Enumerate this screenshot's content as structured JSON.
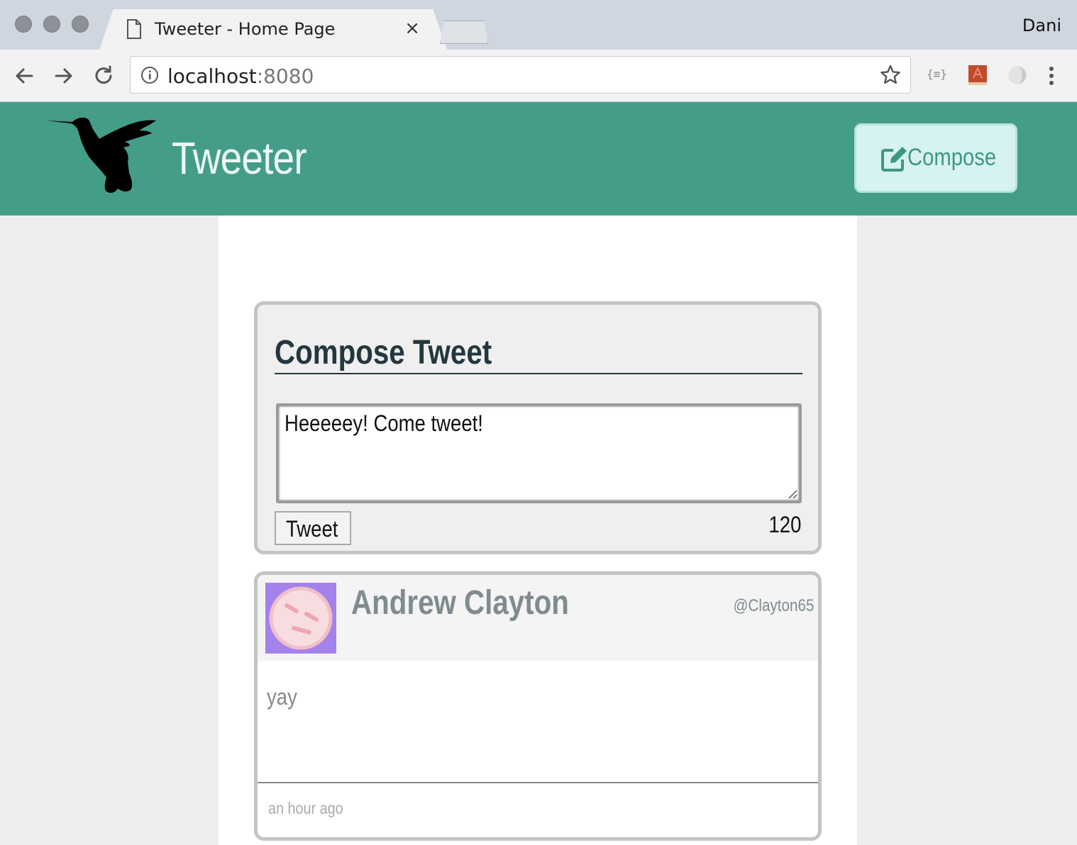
{
  "browser": {
    "tab_title": "Tweeter - Home Page",
    "profile_name": "Dani",
    "url_host": "localhost",
    "url_port": ":8080",
    "icons": [
      "back-icon",
      "forward-icon",
      "reload-icon",
      "info-icon",
      "star-icon",
      "json-extension-icon",
      "book-extension-icon",
      "circle-extension-icon",
      "menu-icon"
    ]
  },
  "header": {
    "app_title": "Tweeter",
    "compose_label": "Compose",
    "colors": {
      "header_bg": "#449d88",
      "compose_bg": "#d6f3f1",
      "compose_text": "#3e9784"
    }
  },
  "compose": {
    "heading": "Compose Tweet",
    "input_value": "Heeeeey! Come tweet!",
    "tweet_button": "Tweet",
    "char_count": "120"
  },
  "tweets": [
    {
      "name": "Andrew Clayton",
      "handle": "@Clayton65",
      "body": "yay",
      "time": "an hour ago",
      "avatar_color": "#a482ec"
    }
  ]
}
